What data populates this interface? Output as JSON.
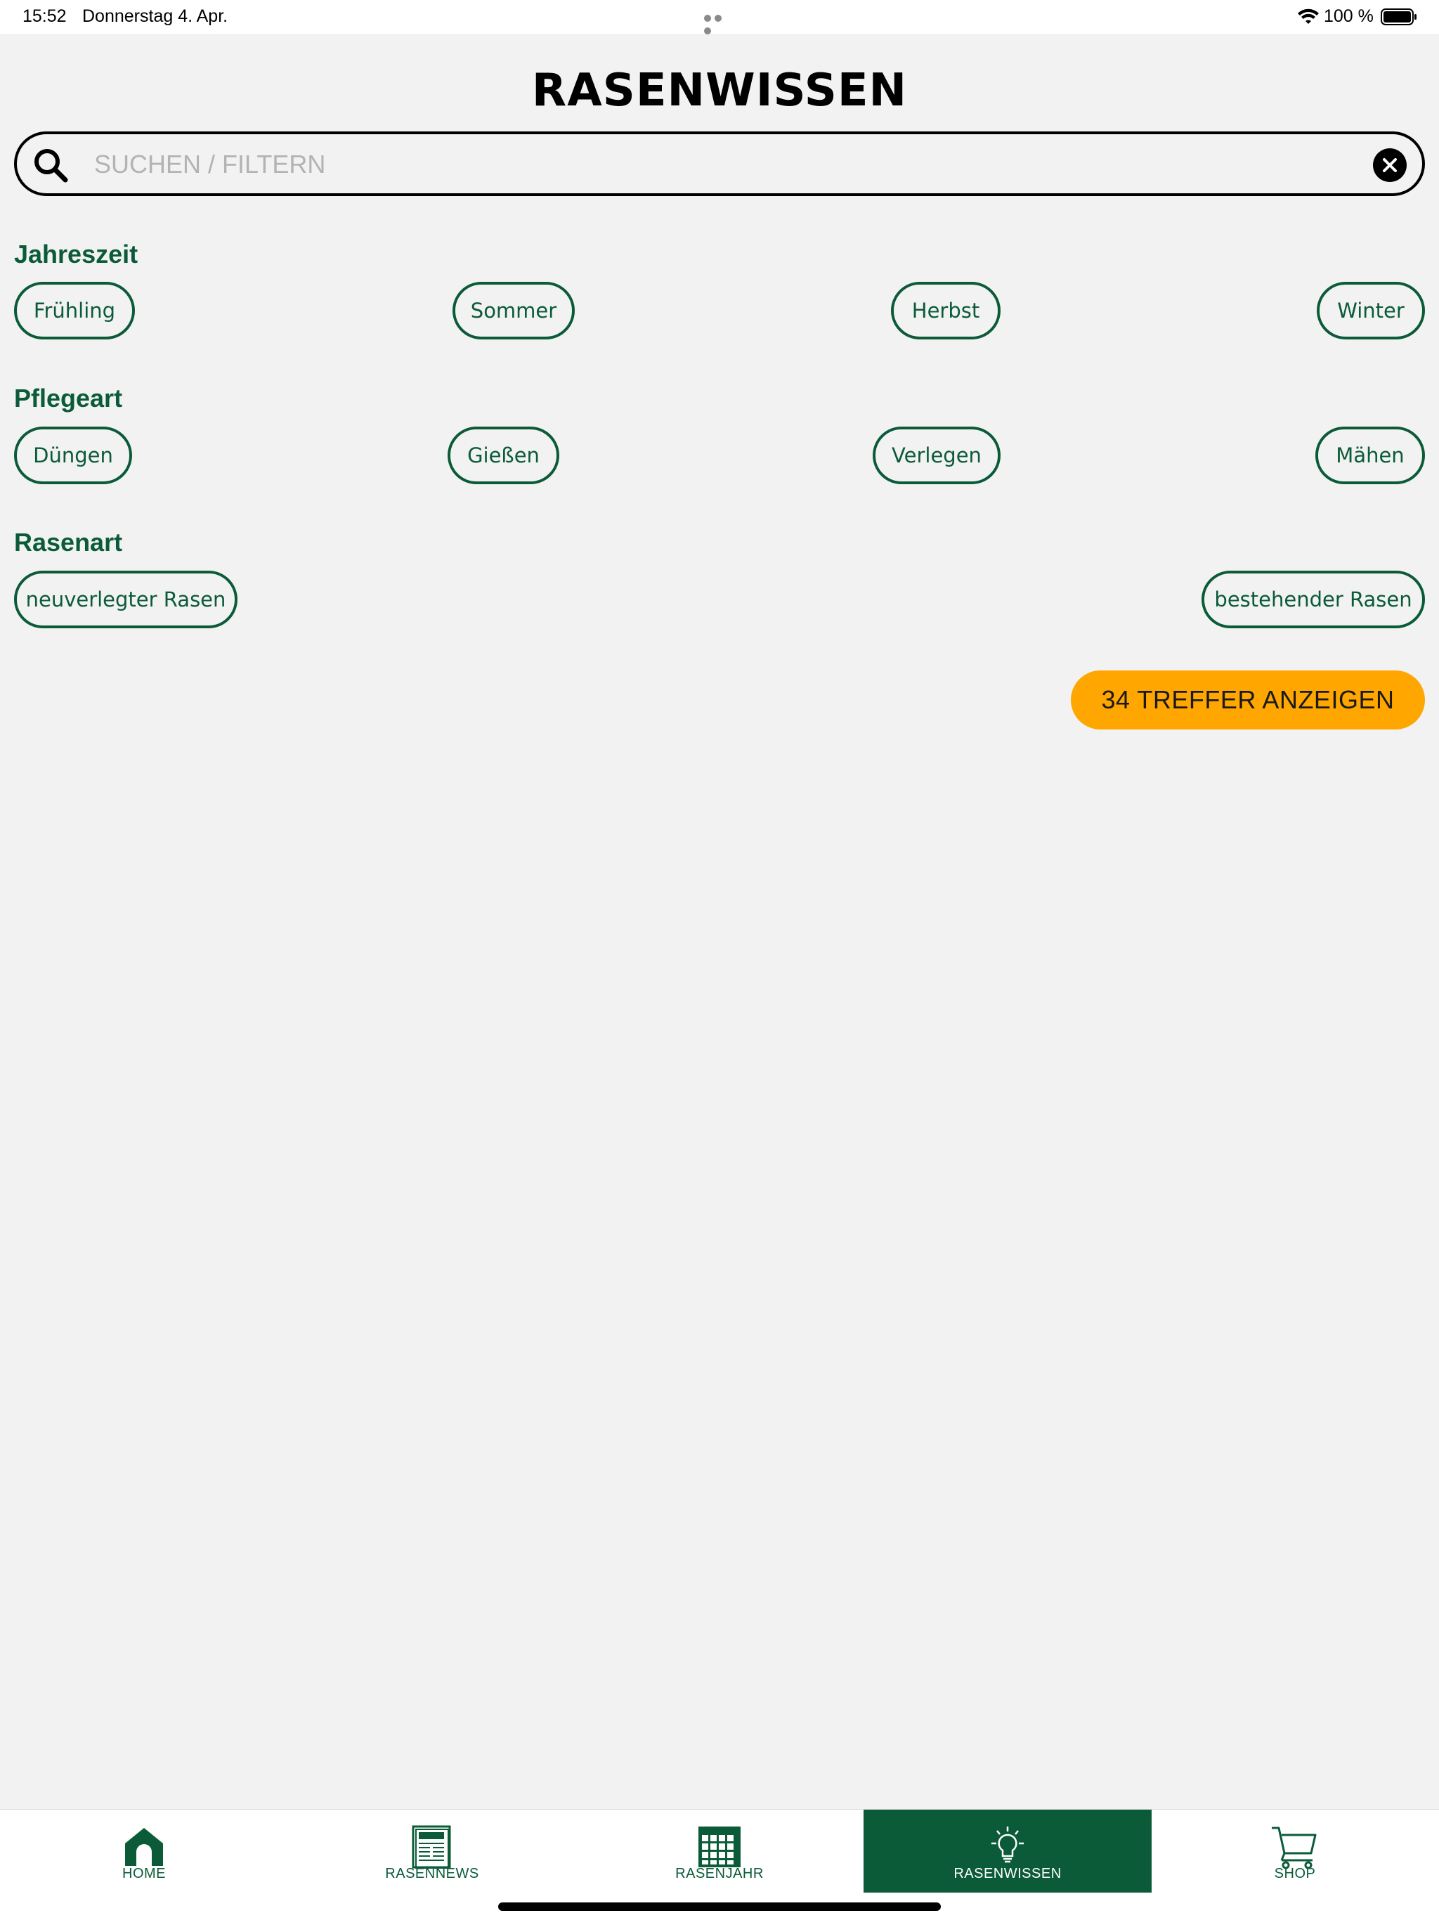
{
  "status_bar": {
    "time": "15:52",
    "date": "Donnerstag 4. Apr.",
    "battery_percent": "100 %"
  },
  "page": {
    "title": "RASENWISSEN"
  },
  "search": {
    "placeholder": "SUCHEN / FILTERN",
    "value": ""
  },
  "filters": {
    "season": {
      "label": "Jahreszeit",
      "options": [
        "Frühling",
        "Sommer",
        "Herbst",
        "Winter"
      ]
    },
    "care_type": {
      "label": "Pflegeart",
      "options": [
        "Düngen",
        "Gießen",
        "Verlegen",
        "Mähen"
      ]
    },
    "lawn_type": {
      "label": "Rasenart",
      "options": [
        "neuverlegter Rasen",
        "bestehender Rasen"
      ]
    }
  },
  "cta": {
    "label": "34 TREFFER ANZEIGEN"
  },
  "tabbar": {
    "tabs": [
      {
        "label": "HOME",
        "icon": "home-icon"
      },
      {
        "label": "RASENNEWS",
        "icon": "newspaper-icon"
      },
      {
        "label": "RASENJAHR",
        "icon": "calendar-icon"
      },
      {
        "label": "RASENWISSEN",
        "icon": "lightbulb-icon"
      },
      {
        "label": "SHOP",
        "icon": "cart-icon"
      }
    ],
    "active_index": 3
  },
  "colors": {
    "brand_green": "#0b5b39",
    "accent_orange": "#ffa600",
    "background": "#f2f2f2"
  }
}
